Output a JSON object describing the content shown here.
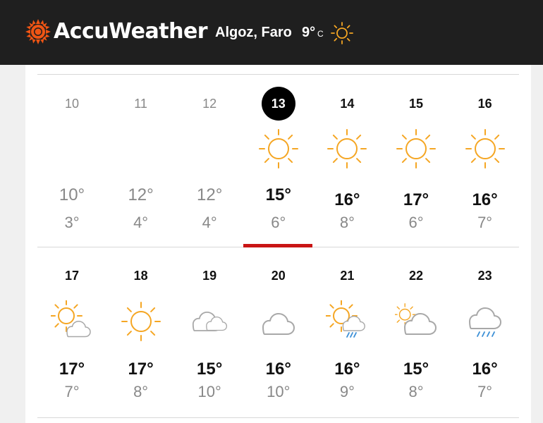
{
  "header": {
    "brand": "AccuWeather",
    "location": "Algoz, Faro",
    "current_temp": "9°",
    "current_unit": "C",
    "current_icon": "sunny-icon",
    "brand_color": "#f05514"
  },
  "calendar": {
    "week1": [
      {
        "day": "10",
        "icon": "",
        "hi": "10°",
        "lo": "3°",
        "state": "past"
      },
      {
        "day": "11",
        "icon": "",
        "hi": "12°",
        "lo": "4°",
        "state": "past"
      },
      {
        "day": "12",
        "icon": "",
        "hi": "12°",
        "lo": "4°",
        "state": "past"
      },
      {
        "day": "13",
        "icon": "sunny-icon",
        "hi": "15°",
        "lo": "6°",
        "state": "today"
      },
      {
        "day": "14",
        "icon": "sunny-icon",
        "hi": "16°",
        "lo": "8°",
        "state": "future"
      },
      {
        "day": "15",
        "icon": "sunny-icon",
        "hi": "17°",
        "lo": "6°",
        "state": "future"
      },
      {
        "day": "16",
        "icon": "sunny-icon",
        "hi": "16°",
        "lo": "7°",
        "state": "future"
      }
    ],
    "week2": [
      {
        "day": "17",
        "icon": "partly-sunny-icon",
        "hi": "17°",
        "lo": "7°"
      },
      {
        "day": "18",
        "icon": "sunny-icon",
        "hi": "17°",
        "lo": "8°"
      },
      {
        "day": "19",
        "icon": "cloudy-icon",
        "hi": "15°",
        "lo": "10°"
      },
      {
        "day": "20",
        "icon": "cloud-icon",
        "hi": "16°",
        "lo": "10°"
      },
      {
        "day": "21",
        "icon": "sun-cloud-rain-icon",
        "hi": "16°",
        "lo": "9°"
      },
      {
        "day": "22",
        "icon": "mostly-cloudy-icon",
        "hi": "15°",
        "lo": "8°"
      },
      {
        "day": "23",
        "icon": "rain-icon",
        "hi": "16°",
        "lo": "7°"
      }
    ]
  },
  "colors": {
    "sun": "#f5a623",
    "cloud": "#a8a8a8",
    "rain": "#3b8fd6",
    "selected_bar": "#c91414"
  }
}
